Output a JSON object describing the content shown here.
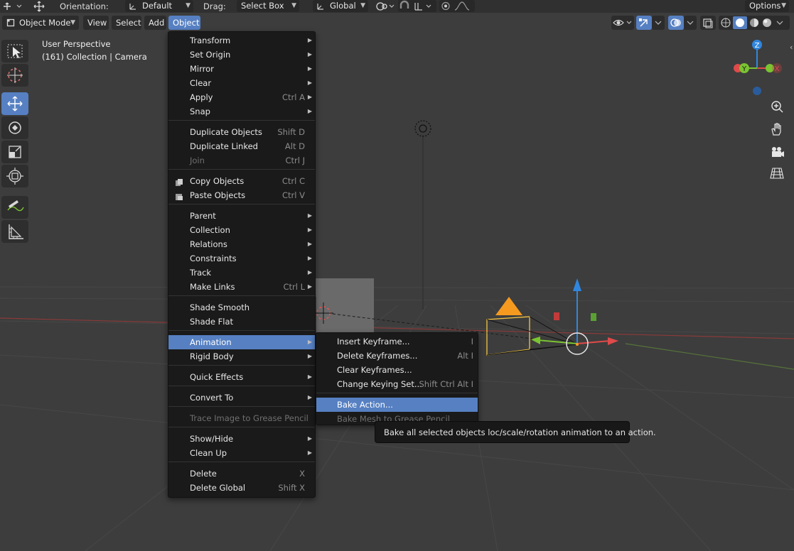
{
  "topbar": {
    "orientation_label": "Orientation:",
    "orientation_value": "Default",
    "drag_label": "Drag:",
    "drag_value": "Select Box",
    "transform_value": "Global",
    "options_label": "Options"
  },
  "header": {
    "mode": "Object Mode",
    "menus": [
      "View",
      "Select",
      "Add",
      "Object"
    ],
    "active_menu": "Object"
  },
  "overlay": {
    "perspective": "User Perspective",
    "collection": "(161) Collection | Camera"
  },
  "gizmo": {
    "z": "Z",
    "y": "Y",
    "x": "X"
  },
  "object_menu": {
    "items": [
      {
        "label": "Transform",
        "shortcut": "",
        "submenu": true
      },
      {
        "label": "Set Origin",
        "shortcut": "",
        "submenu": true
      },
      {
        "label": "Mirror",
        "shortcut": "",
        "submenu": true
      },
      {
        "label": "Clear",
        "shortcut": "",
        "submenu": true
      },
      {
        "label": "Apply",
        "shortcut": "Ctrl A",
        "submenu": true
      },
      {
        "label": "Snap",
        "shortcut": "",
        "submenu": true
      },
      {
        "label": "Duplicate Objects",
        "shortcut": "Shift D"
      },
      {
        "label": "Duplicate Linked",
        "shortcut": "Alt D"
      },
      {
        "label": "Join",
        "shortcut": "Ctrl J",
        "disabled": true
      },
      {
        "label": "Copy Objects",
        "shortcut": "Ctrl C",
        "icon": "copy-icon"
      },
      {
        "label": "Paste Objects",
        "shortcut": "Ctrl V",
        "icon": "paste-icon"
      },
      {
        "label": "Parent",
        "shortcut": "",
        "submenu": true
      },
      {
        "label": "Collection",
        "shortcut": "",
        "submenu": true
      },
      {
        "label": "Relations",
        "shortcut": "",
        "submenu": true
      },
      {
        "label": "Constraints",
        "shortcut": "",
        "submenu": true
      },
      {
        "label": "Track",
        "shortcut": "",
        "submenu": true
      },
      {
        "label": "Make Links",
        "shortcut": "Ctrl L",
        "submenu": true
      },
      {
        "label": "Shade Smooth",
        "shortcut": ""
      },
      {
        "label": "Shade Flat",
        "shortcut": ""
      },
      {
        "label": "Animation",
        "shortcut": "",
        "submenu": true,
        "highlight": true
      },
      {
        "label": "Rigid Body",
        "shortcut": "",
        "submenu": true
      },
      {
        "label": "Quick Effects",
        "shortcut": "",
        "submenu": true
      },
      {
        "label": "Convert To",
        "shortcut": "",
        "submenu": true
      },
      {
        "label": "Trace Image to Grease Pencil",
        "shortcut": "",
        "disabled": true
      },
      {
        "label": "Show/Hide",
        "shortcut": "",
        "submenu": true
      },
      {
        "label": "Clean Up",
        "shortcut": "",
        "submenu": true
      },
      {
        "label": "Delete",
        "shortcut": "X"
      },
      {
        "label": "Delete Global",
        "shortcut": "Shift X"
      }
    ]
  },
  "animation_menu": {
    "items": [
      {
        "label": "Insert Keyframe...",
        "shortcut": "I"
      },
      {
        "label": "Delete Keyframes...",
        "shortcut": "Alt I"
      },
      {
        "label": "Clear Keyframes...",
        "shortcut": ""
      },
      {
        "label": "Change Keying Set...",
        "shortcut": "Shift Ctrl Alt I"
      },
      {
        "label": "Bake Action...",
        "shortcut": "",
        "highlight": true
      },
      {
        "label": "Bake Mesh to Grease Pencil",
        "shortcut": "",
        "disabled": true
      }
    ]
  },
  "tooltip": "Bake all selected objects loc/scale/rotation animation to an action.",
  "colors": {
    "accent": "#5680c2",
    "menu_bg": "#1a1a1a",
    "viewport_bg": "#3d3d3d",
    "axis_x": "#e04a4a",
    "axis_y": "#7ac431",
    "axis_z": "#2f86e0",
    "camera_select": "#f5c542",
    "light_orange": "#f59a1f"
  }
}
